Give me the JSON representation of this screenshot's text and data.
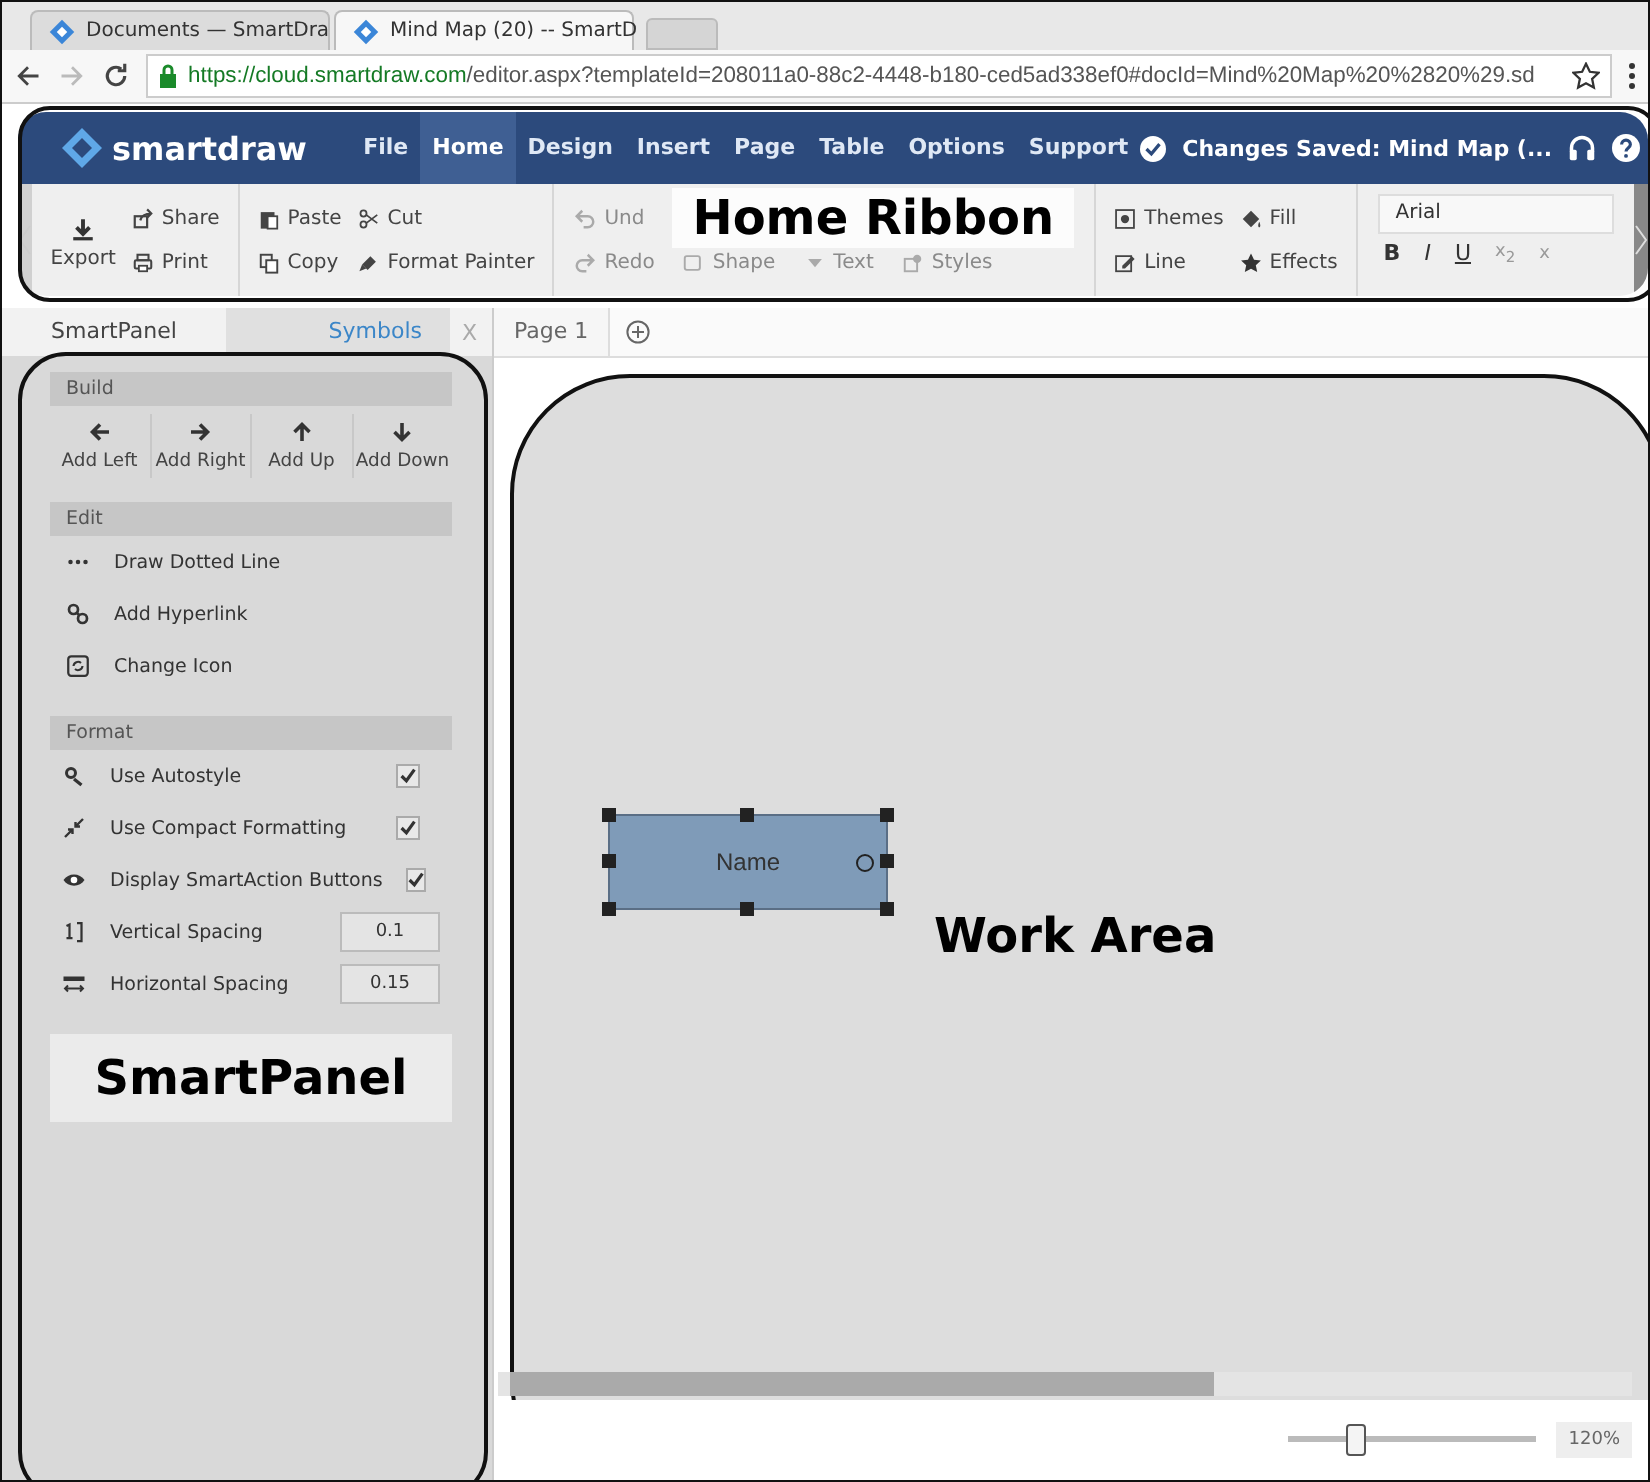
{
  "browser": {
    "tabs": [
      {
        "title": "Documents — SmartDra",
        "selected": false
      },
      {
        "title": "Mind Map (20) -- SmartD",
        "selected": true
      }
    ],
    "url_host": "https://cloud.smartdraw.com",
    "url_path": "/editor.aspx?templateId=208011a0-88c2-4448-b180-ced5ad338ef0#docId=Mind%20Map%20%2820%29.sd"
  },
  "app": {
    "logo": "smartdraw",
    "menu": [
      {
        "label": "File",
        "selected": false
      },
      {
        "label": "Home",
        "selected": true
      },
      {
        "label": "Design",
        "selected": false
      },
      {
        "label": "Insert",
        "selected": false
      },
      {
        "label": "Page",
        "selected": false
      },
      {
        "label": "Table",
        "selected": false
      },
      {
        "label": "Options",
        "selected": false
      },
      {
        "label": "Support",
        "selected": false
      }
    ],
    "status": "Changes Saved: Mind Map (..."
  },
  "ribbon": {
    "callout": "Home Ribbon",
    "groups": [
      {
        "columns": [
          [
            {
              "label": "Export",
              "kind": "big"
            }
          ],
          [
            {
              "label": "Share",
              "kind": "small"
            },
            {
              "label": "Print",
              "kind": "small"
            }
          ]
        ]
      },
      {
        "columns": [
          [
            {
              "label": "Paste",
              "kind": "small"
            },
            {
              "label": "Copy",
              "kind": "small"
            }
          ],
          [
            {
              "label": "Cut",
              "kind": "small"
            },
            {
              "label": "Format Painter",
              "kind": "small"
            }
          ]
        ]
      },
      {
        "rows": [
          [
            {
              "label": "Und",
              "kind": "dim"
            }
          ],
          [
            {
              "label": "Redo",
              "kind": "dim"
            },
            {
              "label": "Shape",
              "kind": "dim"
            },
            {
              "label": "Text",
              "kind": "dim"
            },
            {
              "label": "Styles",
              "kind": "dim"
            }
          ]
        ]
      },
      {
        "columns": [
          [
            {
              "label": "Themes",
              "kind": "small"
            },
            {
              "label": "Line",
              "kind": "small"
            }
          ],
          [
            {
              "label": "Fill",
              "kind": "small"
            },
            {
              "label": "Effects",
              "kind": "small"
            }
          ]
        ]
      }
    ],
    "font": "Arial",
    "format_buttons": [
      "B",
      "I",
      "U",
      "x$_{2}$",
      "x"
    ]
  },
  "panel": {
    "tabs": [
      {
        "label": "SmartPanel",
        "selected": true
      },
      {
        "label": "Symbols",
        "selected": false
      }
    ],
    "close": "X",
    "build_title": "Build",
    "build": [
      "Add Left",
      "Add Right",
      "Add Up",
      "Add Down"
    ],
    "edit_title": "Edit",
    "edit": [
      "Draw Dotted Line",
      "Add Hyperlink",
      "Change Icon"
    ],
    "format_title": "Format",
    "format": [
      {
        "label": "Use Autostyle",
        "kind": "checkbox",
        "checked": true
      },
      {
        "label": "Use Compact Formatting",
        "kind": "checkbox",
        "checked": true
      },
      {
        "label": "Display SmartAction Buttons",
        "kind": "checkbox",
        "checked": true
      },
      {
        "label": "Vertical Spacing",
        "kind": "number",
        "value": "0.1"
      },
      {
        "label": "Horizontal Spacing",
        "kind": "number",
        "value": "0.15"
      }
    ],
    "callout": "SmartPanel"
  },
  "page_tabs": [
    {
      "label": "Page 1",
      "selected": true
    }
  ],
  "work_area": {
    "callout": "Work Area",
    "node": "Name",
    "zoom": {
      "level": 0.27,
      "reading": "120%"
    }
  }
}
